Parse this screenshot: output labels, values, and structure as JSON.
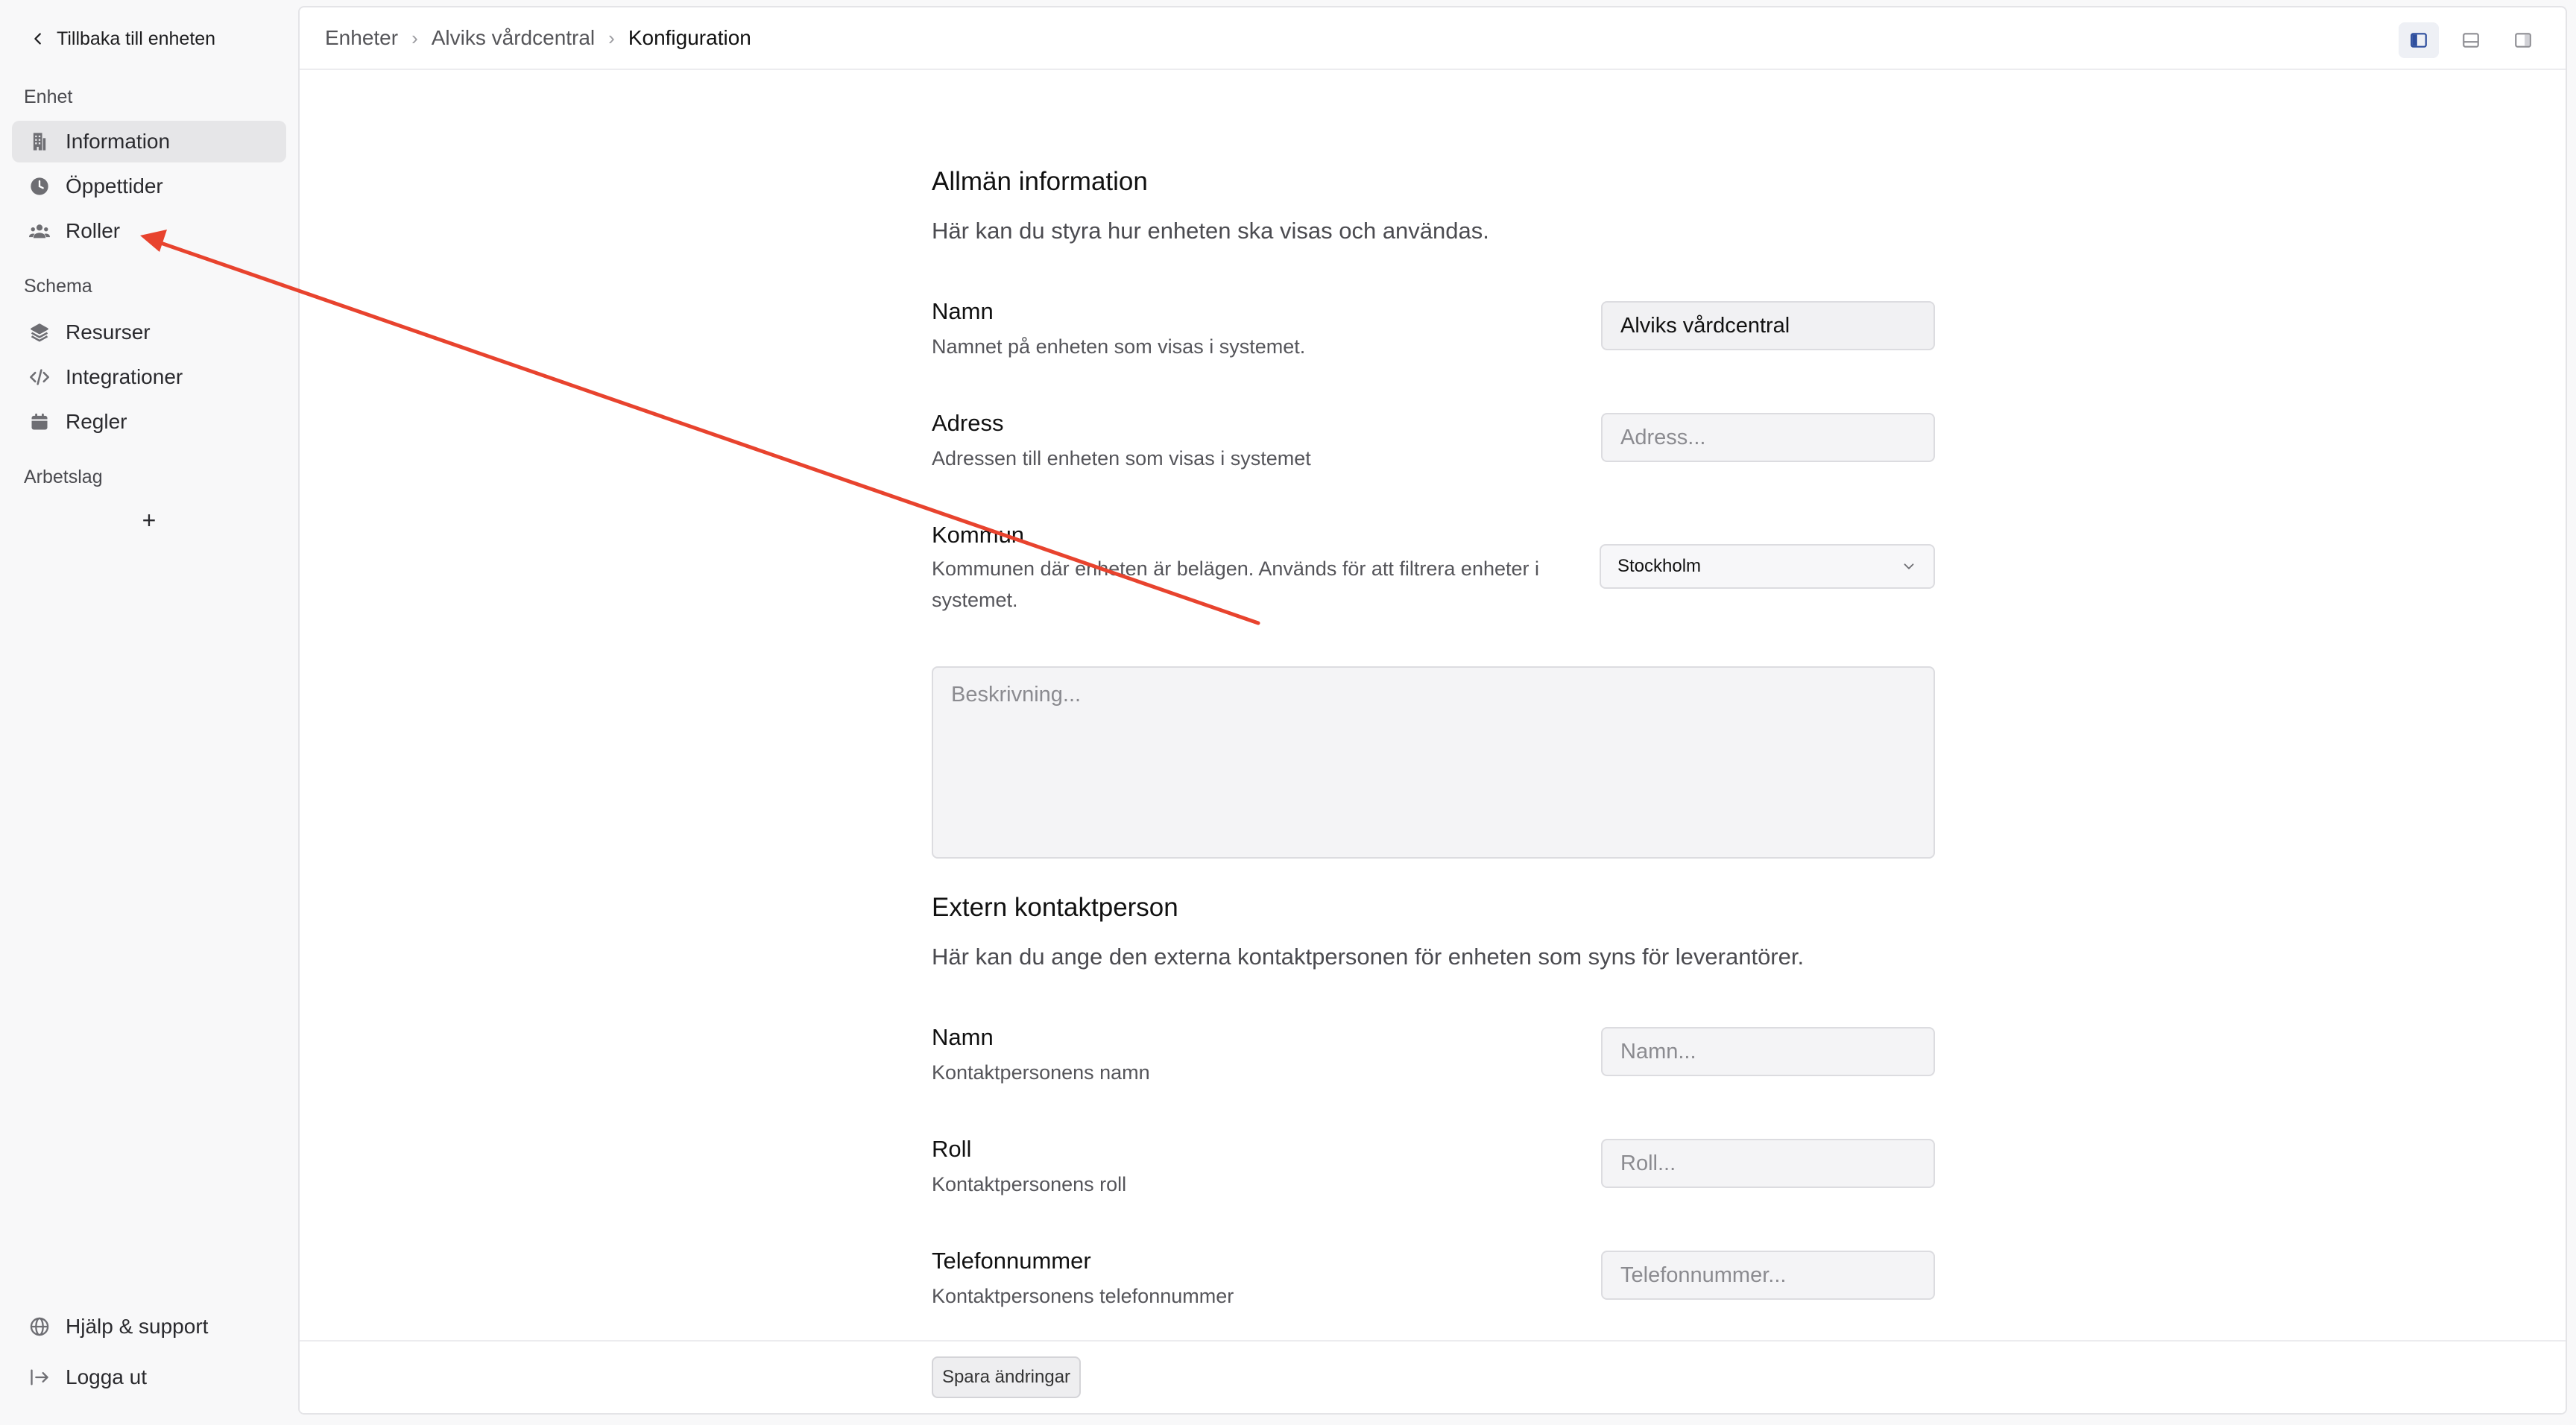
{
  "sidebar": {
    "back_label": "Tillbaka till enheten",
    "sections": [
      {
        "label": "Enhet"
      },
      {
        "label": "Schema"
      },
      {
        "label": "Arbetslag"
      }
    ],
    "items": [
      {
        "label": "Information",
        "icon": "building-icon",
        "active": true
      },
      {
        "label": "Öppettider",
        "icon": "clock-icon"
      },
      {
        "label": "Roller",
        "icon": "users-icon"
      },
      {
        "label": "Resurser",
        "icon": "stack-icon"
      },
      {
        "label": "Integrationer",
        "icon": "code-icon"
      },
      {
        "label": "Regler",
        "icon": "calendar-icon"
      }
    ],
    "add_team_label": "+",
    "footer": [
      {
        "label": "Hjälp & support",
        "icon": "globe-icon"
      },
      {
        "label": "Logga ut",
        "icon": "logout-icon"
      }
    ]
  },
  "breadcrumb": [
    "Enheter",
    "Alviks vårdcentral",
    "Konfiguration"
  ],
  "general": {
    "title": "Allmän information",
    "description": "Här kan du styra hur enheten ska visas och användas.",
    "name": {
      "label": "Namn",
      "help": "Namnet på enheten som visas i systemet.",
      "value": "Alviks vårdcentral"
    },
    "address": {
      "label": "Adress",
      "help": "Adressen till enheten som visas i systemet",
      "placeholder": "Adress..."
    },
    "municipality": {
      "label": "Kommun",
      "help": "Kommunen där enheten är belägen. Används för att filtrera enheter i systemet.",
      "selected": "Stockholm"
    },
    "description_field": {
      "placeholder": "Beskrivning..."
    }
  },
  "contact": {
    "title": "Extern kontaktperson",
    "description": "Här kan du ange den externa kontaktpersonen för enheten som syns för leverantörer.",
    "name": {
      "label": "Namn",
      "help": "Kontaktpersonens namn",
      "placeholder": "Namn..."
    },
    "role": {
      "label": "Roll",
      "help": "Kontaktpersonens roll",
      "placeholder": "Roll..."
    },
    "phone": {
      "label": "Telefonnummer",
      "help": "Kontaktpersonens telefonnummer",
      "placeholder": "Telefonnummer..."
    }
  },
  "footer": {
    "save_label": "Spara ändringar"
  },
  "colors": {
    "annotation_arrow": "#e8432e",
    "active_toggle": "#2f4f9e"
  }
}
